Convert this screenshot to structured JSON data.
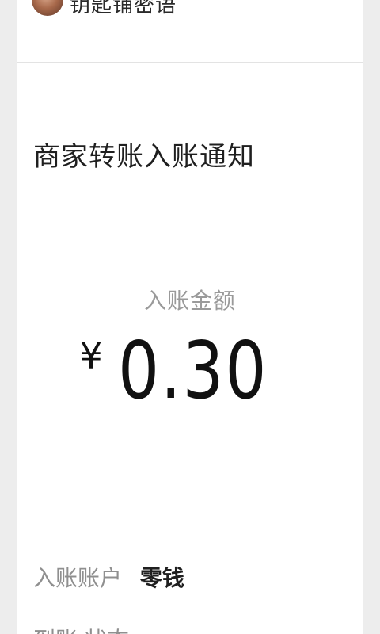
{
  "header": {
    "account_name": "钥匙铺密语"
  },
  "notification": {
    "title": "商家转账入账通知",
    "amount_label": "入账金额",
    "currency": "¥",
    "amount": "0.30",
    "account_label": "入账账户",
    "account_value": "零钱",
    "next_row_partial": "到账 状态"
  },
  "icons": {
    "avatar": "avatar-image"
  }
}
